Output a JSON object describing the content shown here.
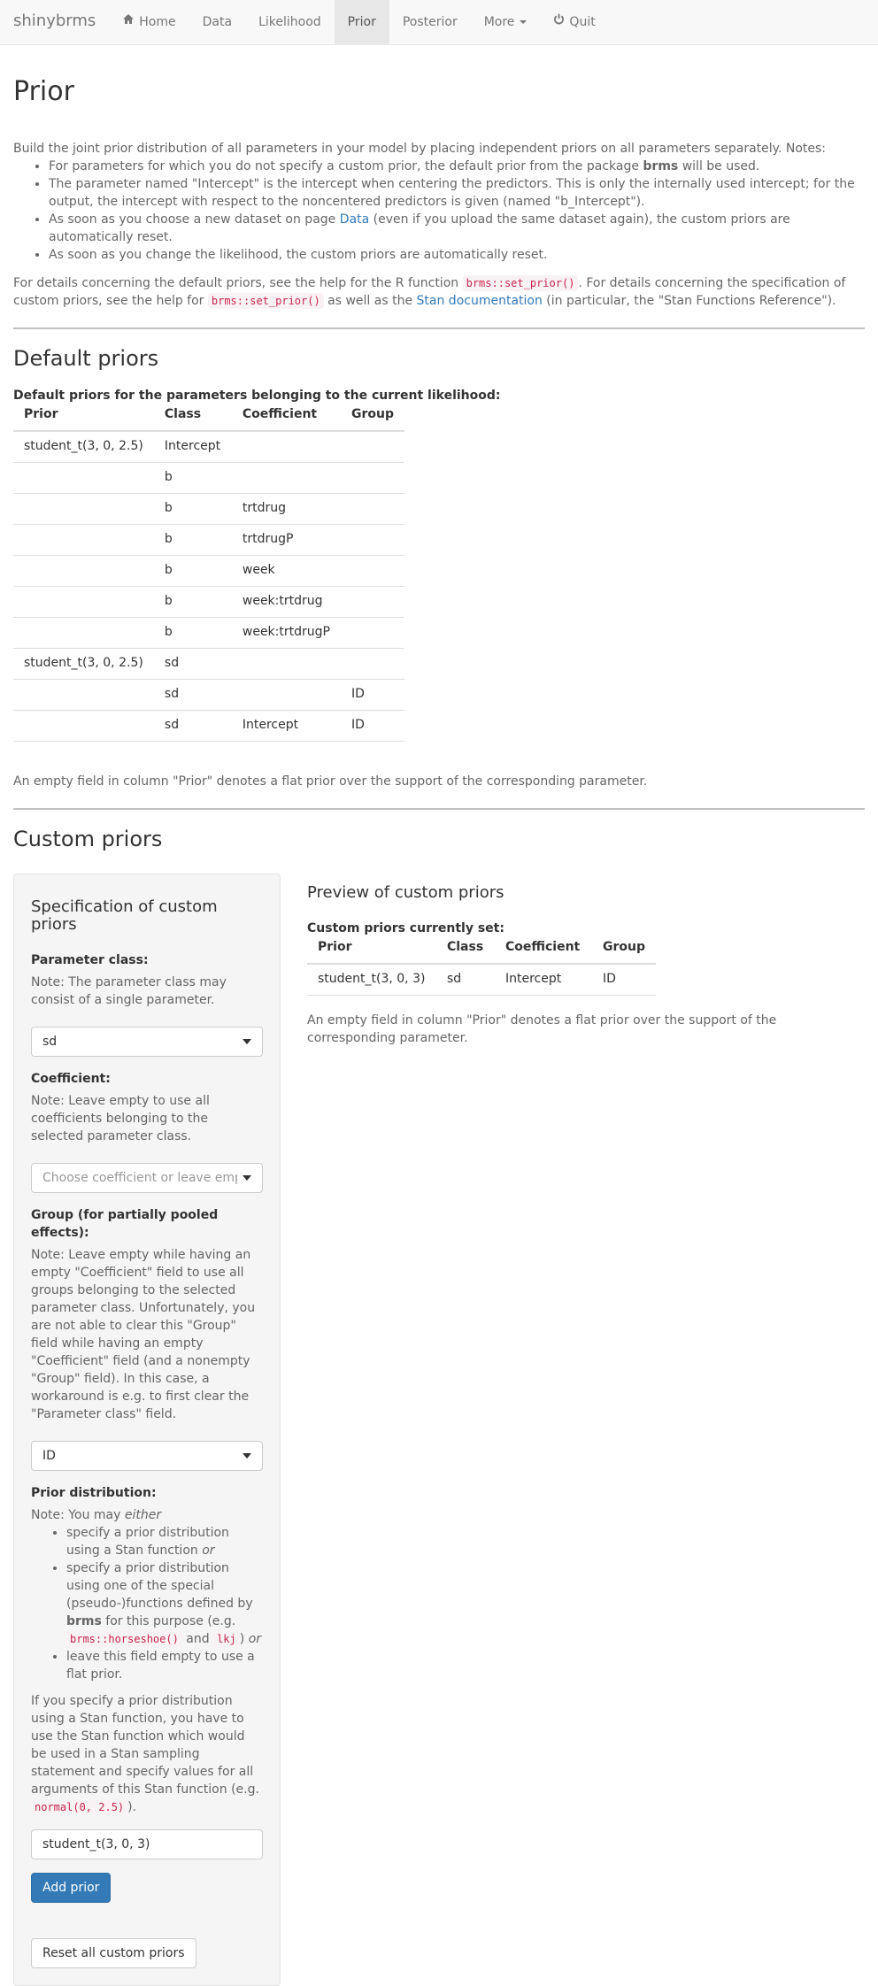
{
  "nav": {
    "brand": "shinybrms",
    "home": "Home",
    "data": "Data",
    "likelihood": "Likelihood",
    "prior": "Prior",
    "posterior": "Posterior",
    "more": "More",
    "quit": "Quit"
  },
  "page": {
    "title": "Prior",
    "intro": "Build the joint prior distribution of all parameters in your model by placing independent priors on all parameters separately. Notes:",
    "bullet1_pre": "For parameters for which you do not specify a custom prior, the default prior from the package ",
    "bullet1_bold": "brms",
    "bullet1_post": " will be used.",
    "bullet2": "The parameter named \"Intercept\" is the intercept when centering the predictors. This is only the internally used intercept; for the output, the intercept with respect to the noncentered predictors is given (named \"b_Intercept\").",
    "bullet3_pre": "As soon as you choose a new dataset on page ",
    "bullet3_link": "Data",
    "bullet3_post": " (even if you upload the same dataset again), the custom priors are automatically reset.",
    "bullet4": "As soon as you change the likelihood, the custom priors are automatically reset.",
    "details_1": "For details concerning the default priors, see the help for the R function ",
    "details_code1": "brms::set_prior()",
    "details_2": ". For details concerning the specification of custom priors, see the help for ",
    "details_code2": "brms::set_prior()",
    "details_3": " as well as the ",
    "details_link": "Stan documentation",
    "details_4": " (in particular, the \"Stan Functions Reference\")."
  },
  "default_priors": {
    "heading": "Default priors",
    "caption": "Default priors for the parameters belonging to the current likelihood:",
    "columns": [
      "Prior",
      "Class",
      "Coefficient",
      "Group"
    ],
    "rows": [
      [
        "student_t(3, 0, 2.5)",
        "Intercept",
        "",
        ""
      ],
      [
        "",
        "b",
        "",
        ""
      ],
      [
        "",
        "b",
        "trtdrug",
        ""
      ],
      [
        "",
        "b",
        "trtdrugP",
        ""
      ],
      [
        "",
        "b",
        "week",
        ""
      ],
      [
        "",
        "b",
        "week:trtdrug",
        ""
      ],
      [
        "",
        "b",
        "week:trtdrugP",
        ""
      ],
      [
        "student_t(3, 0, 2.5)",
        "sd",
        "",
        ""
      ],
      [
        "",
        "sd",
        "",
        "ID"
      ],
      [
        "",
        "sd",
        "Intercept",
        "ID"
      ]
    ],
    "note": "An empty field in column \"Prior\" denotes a flat prior over the support of the corresponding parameter."
  },
  "custom": {
    "heading": "Custom priors",
    "spec_title": "Specification of custom priors",
    "param_class_label": "Parameter class:",
    "param_class_note": "Note: The parameter class may consist of a single parameter.",
    "param_class_value": "sd",
    "coef_label": "Coefficient:",
    "coef_note": "Note: Leave empty to use all coefficients belonging to the selected parameter class.",
    "coef_placeholder": "Choose coefficient or leave empty",
    "group_label": "Group (for partially pooled effects):",
    "group_note": "Note: Leave empty while having an empty \"Coefficient\" field to use all groups belonging to the selected parameter class. Unfortunately, you are not able to clear this \"Group\" field while having an empty \"Coefficient\" field (and a nonempty \"Group\" field). In this case, a workaround is e.g. to first clear the \"Parameter class\" field.",
    "group_value": "ID",
    "dist_label": "Prior distribution:",
    "dist_note_pre": "Note: You may ",
    "dist_note_em": "either",
    "dist_b1": "specify a prior distribution using a Stan function ",
    "dist_b1_em": "or",
    "dist_b2_pre": "specify a prior distribution using one of the special (pseudo-)functions defined by ",
    "dist_b2_bold": "brms",
    "dist_b2_mid": " for this purpose (e.g. ",
    "dist_b2_code1": "brms::horseshoe()",
    "dist_b2_and": " and ",
    "dist_b2_code2": "lkj",
    "dist_b2_close": ")",
    "dist_b2_em": "or",
    "dist_b3": "leave this field empty to use a flat prior.",
    "dist_para_pre": "If you specify a prior distribution using a Stan function, you have to use the Stan function which would be used in a Stan sampling statement and specify values for all arguments of this Stan function (e.g. ",
    "dist_para_code": "normal(0, 2.5)",
    "dist_para_post": ").",
    "dist_input_value": "student_t(3, 0, 3)",
    "add_button": "Add prior",
    "reset_button": "Reset all custom priors",
    "preview_title": "Preview of custom priors",
    "preview_caption": "Custom priors currently set:",
    "preview_columns": [
      "Prior",
      "Class",
      "Coefficient",
      "Group"
    ],
    "preview_rows": [
      [
        "student_t(3, 0, 3)",
        "sd",
        "Intercept",
        "ID"
      ]
    ],
    "preview_note": "An empty field in column \"Prior\" denotes a flat prior over the support of the corresponding parameter."
  },
  "icons": {
    "home": "home-icon",
    "quit": "power-icon"
  }
}
